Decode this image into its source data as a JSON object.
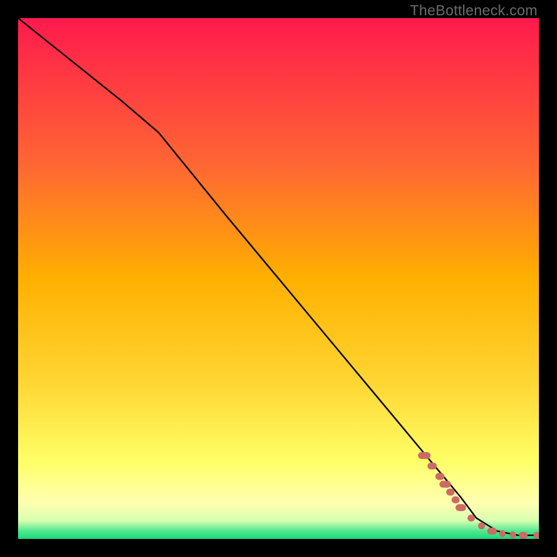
{
  "watermark": "TheBottleneck.com",
  "colors": {
    "bg": "#000000",
    "curve": "#000000",
    "marker": "#cc6b66",
    "grad_top": "#ff1a4d",
    "grad_mid1": "#ff8a33",
    "grad_mid2": "#ffd633",
    "grad_mid3": "#ffff66",
    "grad_mid4": "#ffffb0",
    "grad_bot": "#1adb7a"
  },
  "chart_data": {
    "type": "line",
    "title": "",
    "xlabel": "",
    "ylabel": "",
    "xlim": [
      0,
      100
    ],
    "ylim": [
      0,
      100
    ],
    "series": [
      {
        "name": "curve",
        "x": [
          0,
          10,
          20,
          27,
          40,
          55,
          70,
          80,
          85,
          88,
          92,
          96,
          100
        ],
        "y": [
          100,
          92,
          84,
          78,
          62,
          44,
          26,
          14,
          8,
          4,
          1.5,
          0.7,
          0.7
        ]
      }
    ],
    "markers": {
      "name": "highlight-points",
      "x": [
        78,
        79.5,
        81,
        82,
        83,
        84,
        85,
        87,
        89,
        91,
        93,
        95,
        97,
        99.5
      ],
      "y": [
        16,
        14,
        12,
        10.5,
        9,
        7.5,
        6,
        4,
        2.5,
        1.5,
        1,
        0.8,
        0.7,
        0.7
      ]
    }
  }
}
